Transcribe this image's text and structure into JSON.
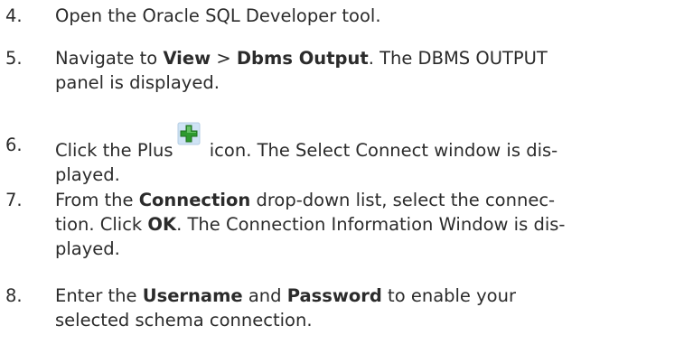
{
  "steps": [
    {
      "number": "4.",
      "text": "Open the Oracle SQL Developer tool."
    },
    {
      "number": "5.",
      "t1": "Navigate to ",
      "b1": "View",
      "t2": " > ",
      "b2": "Dbms Output",
      "t3": ". The DBMS OUTPUT",
      "t4": "panel is displayed."
    },
    {
      "number": "6.",
      "t1": "Click the Plus",
      "icon": "plus-icon",
      "t2": " icon. The Select Connect window is dis-",
      "t3": "played."
    },
    {
      "number": "7.",
      "t1": "From the ",
      "b1": "Connection",
      "t2": " drop-down list, select the connec-",
      "t3": "tion. Click ",
      "b2": "OK",
      "t4": ". The Connection Information Window is dis-",
      "t5": "played."
    },
    {
      "number": "8.",
      "t1": "Enter the ",
      "b1": "Username",
      "t2": " and ",
      "b2": "Password",
      "t3": " to enable your",
      "t4": "selected schema connection."
    }
  ],
  "colors": {
    "text": "#2b2b2b",
    "icon_green": "#2e9a2e",
    "icon_bg": "#cfe3f5"
  }
}
